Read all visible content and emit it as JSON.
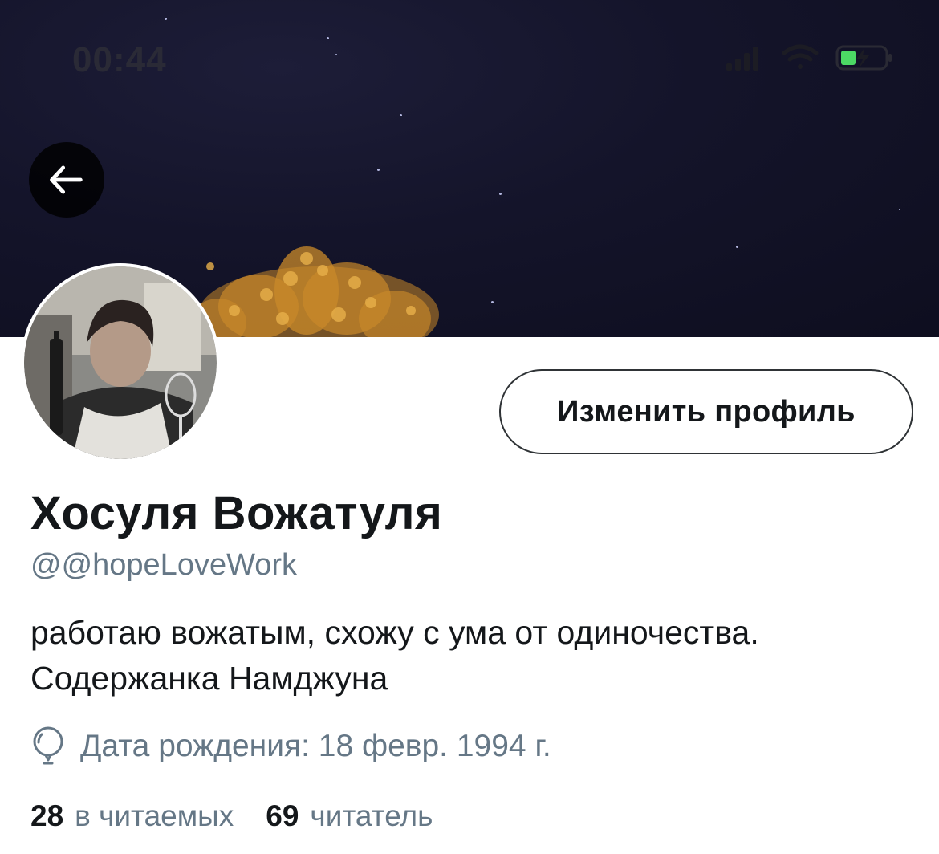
{
  "status_bar": {
    "time": "00:44"
  },
  "header": {
    "back_icon": "arrow-left-icon"
  },
  "profile": {
    "edit_button_label": "Изменить профиль",
    "display_name": "Хосуля Вожатуля",
    "handle": "@@hopeLoveWork",
    "bio": "работаю вожатым, схожу с ума от одиночества. Содержанка Намджуна",
    "birthday": "Дата рождения: 18 февр. 1994 г.",
    "birthday_icon": "balloon-icon"
  },
  "stats": {
    "following_count": "28",
    "following_label": "в читаемых",
    "followers_count": "69",
    "followers_label": "читатель"
  },
  "colors": {
    "banner": "#14142a",
    "secondary_text": "#657786",
    "primary_text": "#14171a",
    "battery_green": "#4cd964"
  }
}
